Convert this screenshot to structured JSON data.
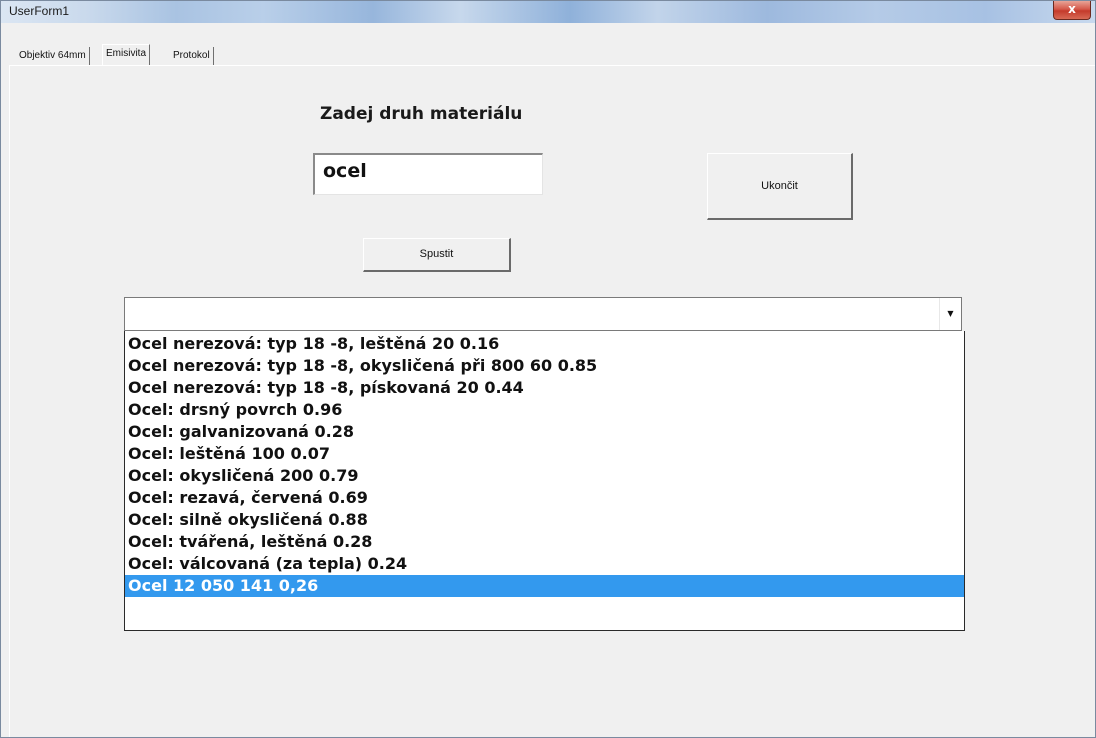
{
  "window": {
    "title": "UserForm1",
    "close_label": "x"
  },
  "tabs": [
    {
      "label": "Objektiv 64mm",
      "active": false
    },
    {
      "label": "Emisivita",
      "active": true
    },
    {
      "label": "Protokol",
      "active": false
    }
  ],
  "form": {
    "heading": "Zadej druh materiálu",
    "material_value": "ocel",
    "exit_label": "Ukončit",
    "run_label": "Spustit"
  },
  "combo": {
    "value": "",
    "arrow_icon": "dropdown-arrow-icon"
  },
  "list": {
    "items": [
      "Ocel nerezová: typ 18 -8, leštěná  20  0.16",
      "Ocel nerezová: typ 18 -8, okysličená při 800  60  0.85",
      "Ocel nerezová: typ 18 -8, pískovaná  20  0.44",
      "Ocel: drsný povrch    0.96",
      "Ocel: galvanizovaná    0.28",
      "Ocel: leštěná  100  0.07",
      "Ocel: okysličená  200  0.79",
      "Ocel: rezavá, červená    0.69",
      "Ocel: silně okysličená    0.88",
      "Ocel: tvářená, leštěná    0.28",
      "Ocel: válcovaná (za tepla)    0.24",
      "Ocel 12 050  141  0,26"
    ],
    "selected_index": 11
  },
  "colors": {
    "selection": "#3399ee",
    "window_bg": "#f0f0f0"
  }
}
